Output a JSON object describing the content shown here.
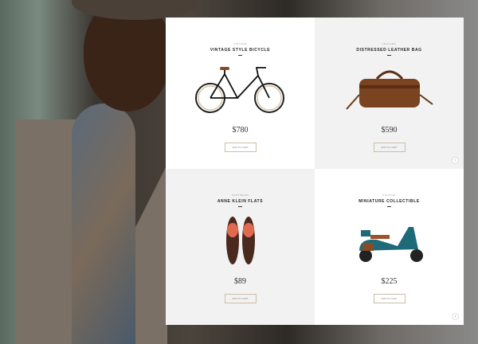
{
  "products": [
    {
      "category": "Vintage",
      "title": "Vintage Style Bicycle",
      "price": "$780",
      "button": "Add to cart"
    },
    {
      "category": "Leather",
      "title": "Distressed Leather Bag",
      "price": "$590",
      "button": "Add to cart"
    },
    {
      "category": "Footwear",
      "title": "Anne Klein Flats",
      "price": "$89",
      "button": "Add to cart"
    },
    {
      "category": "Vintage",
      "title": "Miniature Collectible",
      "price": "$225",
      "button": "Add to cart"
    }
  ],
  "scroll_up_icon": "↑"
}
